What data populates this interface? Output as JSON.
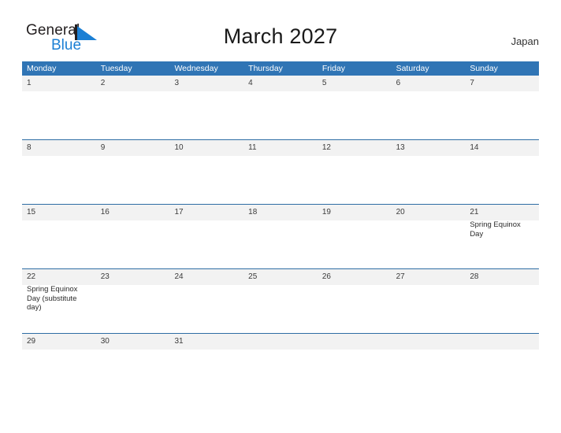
{
  "brand": {
    "name_part1": "General",
    "name_part2": "Blue",
    "mark_icon": "triangle-flag-icon",
    "color_dark": "#231f20",
    "color_blue": "#1b7fd4"
  },
  "header": {
    "title": "March 2027",
    "country": "Japan"
  },
  "colors": {
    "header_blue": "#3075b5",
    "row_border_blue": "#2e6da4",
    "day_band_gray": "#f2f2f2",
    "page_background": "#ffffff"
  },
  "weekdays": [
    "Monday",
    "Tuesday",
    "Wednesday",
    "Thursday",
    "Friday",
    "Saturday",
    "Sunday"
  ],
  "weeks": [
    {
      "days": [
        {
          "number": "1",
          "events": []
        },
        {
          "number": "2",
          "events": []
        },
        {
          "number": "3",
          "events": []
        },
        {
          "number": "4",
          "events": []
        },
        {
          "number": "5",
          "events": []
        },
        {
          "number": "6",
          "events": []
        },
        {
          "number": "7",
          "events": []
        }
      ]
    },
    {
      "days": [
        {
          "number": "8",
          "events": []
        },
        {
          "number": "9",
          "events": []
        },
        {
          "number": "10",
          "events": []
        },
        {
          "number": "11",
          "events": []
        },
        {
          "number": "12",
          "events": []
        },
        {
          "number": "13",
          "events": []
        },
        {
          "number": "14",
          "events": []
        }
      ]
    },
    {
      "days": [
        {
          "number": "15",
          "events": []
        },
        {
          "number": "16",
          "events": []
        },
        {
          "number": "17",
          "events": []
        },
        {
          "number": "18",
          "events": []
        },
        {
          "number": "19",
          "events": []
        },
        {
          "number": "20",
          "events": []
        },
        {
          "number": "21",
          "events": [
            "Spring Equinox Day"
          ]
        }
      ]
    },
    {
      "days": [
        {
          "number": "22",
          "events": [
            "Spring Equinox Day (substitute day)"
          ]
        },
        {
          "number": "23",
          "events": []
        },
        {
          "number": "24",
          "events": []
        },
        {
          "number": "25",
          "events": []
        },
        {
          "number": "26",
          "events": []
        },
        {
          "number": "27",
          "events": []
        },
        {
          "number": "28",
          "events": []
        }
      ]
    },
    {
      "days": [
        {
          "number": "29",
          "events": []
        },
        {
          "number": "30",
          "events": []
        },
        {
          "number": "31",
          "events": []
        },
        {
          "number": "",
          "events": []
        },
        {
          "number": "",
          "events": []
        },
        {
          "number": "",
          "events": []
        },
        {
          "number": "",
          "events": []
        }
      ]
    }
  ]
}
